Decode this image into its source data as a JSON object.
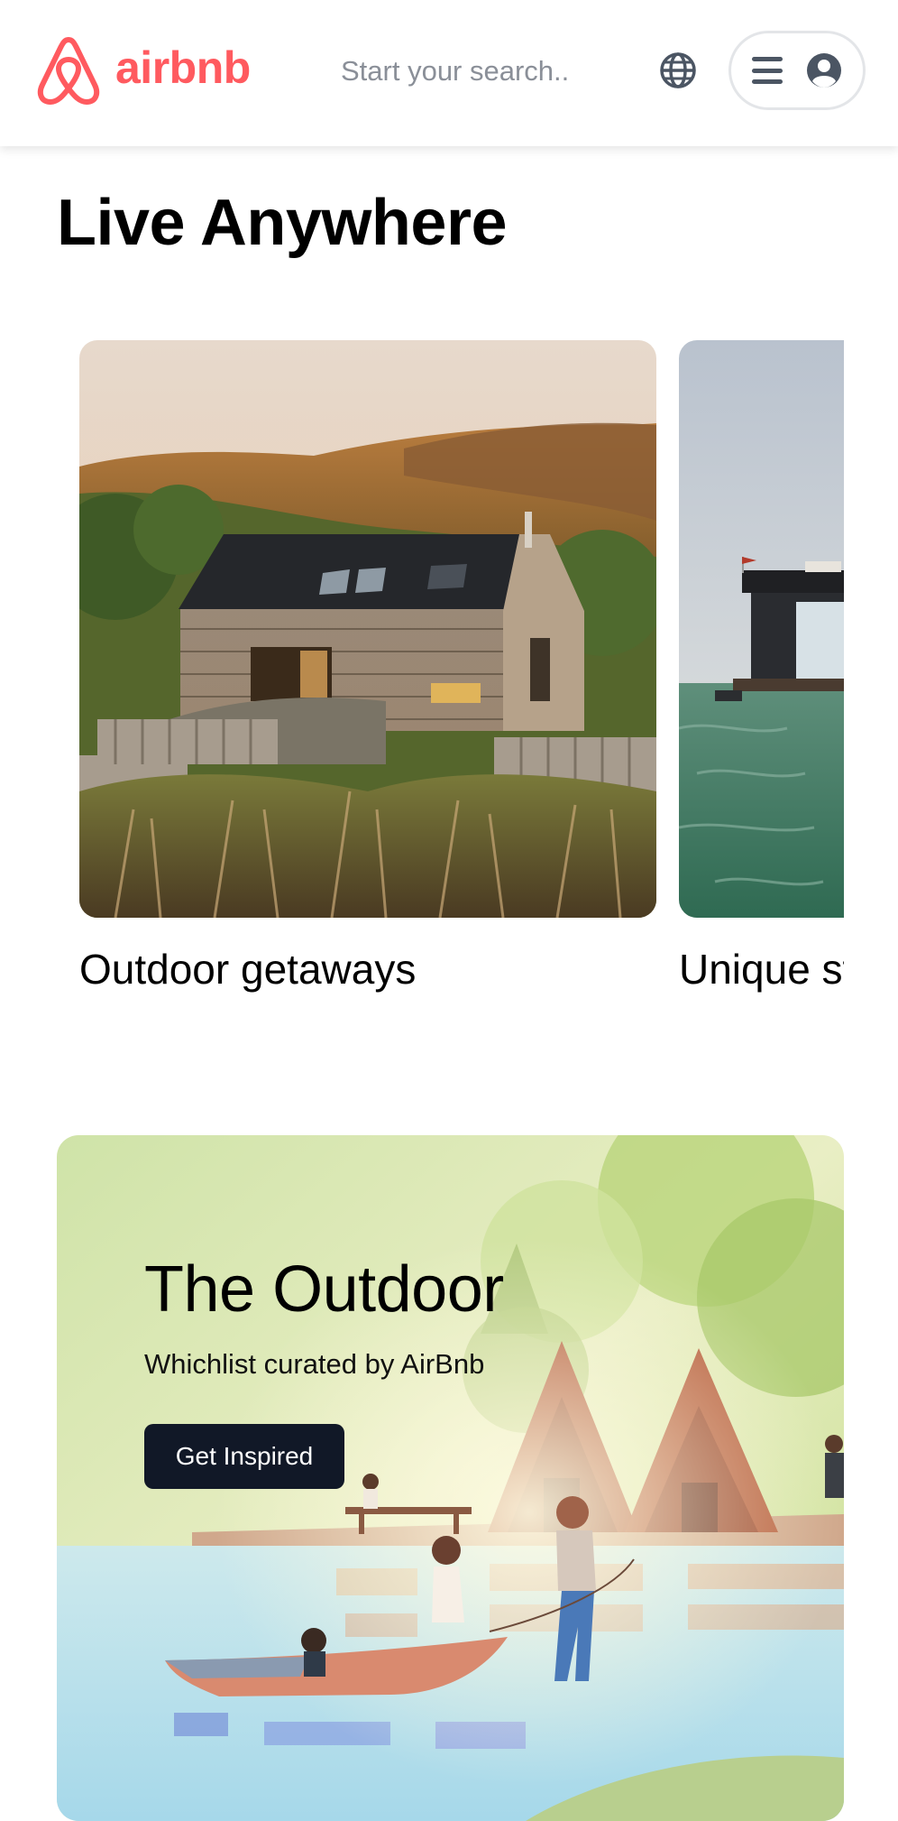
{
  "header": {
    "brand": "airbnb",
    "brand_color": "#FF5A5F",
    "search_placeholder": "Start your search..",
    "icons": [
      "airbnb-logo-icon",
      "globe-icon",
      "menu-icon",
      "user-avatar-icon"
    ]
  },
  "main": {
    "title": "Live Anywhere",
    "cards": [
      {
        "label": "Outdoor getaways",
        "image": "wooden cabin on a hillside at sunset"
      },
      {
        "label": "Unique stays",
        "image": "floating house on the sea"
      }
    ]
  },
  "banner": {
    "title": "The Outdoor",
    "subtitle": "Whichlist curated by AirBnb",
    "button_label": "Get Inspired",
    "button_color": "#111827"
  }
}
